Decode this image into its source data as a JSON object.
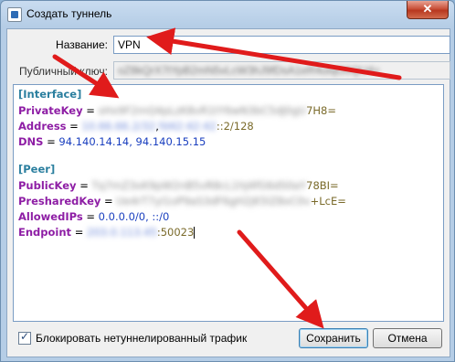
{
  "window": {
    "title": "Создать туннель",
    "close_label": "✕"
  },
  "form": {
    "name_label": "Название:",
    "name_value": "VPN",
    "public_key_label": "Публичный ключ:",
    "public_key_value": "oZ8kQrX7tYpB2mN5vLcW3hJ9fDsA1eR4uIqO0QU4="
  },
  "editor": {
    "interface_header": "[Interface]",
    "private_key_label": "PrivateKey",
    "private_key_blurred": "sHx9F2mQ4pLzK8vR1tY6wN3bC5dJ0gU",
    "private_key_tail": "7H8=",
    "address_label": "Address",
    "address_blurred_1": "10.66.66.2/32",
    "address_sep": ",",
    "address_blurred_2": "fd42:42:42",
    "address_tail": "::2/128",
    "dns_label": "DNS",
    "dns_value": "94.140.14.14, 94.140.15.15",
    "peer_header": "[Peer]",
    "public_key_label": "PublicKey",
    "public_key_blurred": "Tq7mZ3xK9pW2nB5vR8cL1hJ4fG6dS0aY",
    "public_key_tail": "78BI=",
    "preshared_key_label": "PresharedKey",
    "preshared_key_blurred": "Ue4rT7yI1oP9aS3dF6gH2jK5lZ8xC0v",
    "preshared_key_tail": "+LcE=",
    "allowed_ips_label": "AllowedIPs",
    "allowed_ips_value": "0.0.0.0/0, ::/0",
    "endpoint_label": "Endpoint",
    "endpoint_blurred": "203.0.113.45",
    "endpoint_port": ":50023",
    "equals": " = "
  },
  "footer": {
    "block_untunneled_label": "Блокировать нетуннелированный трафик",
    "block_untunneled_checked": true,
    "save_label": "Сохранить",
    "cancel_label": "Отмена"
  },
  "annotation_color": "#e01b1b"
}
